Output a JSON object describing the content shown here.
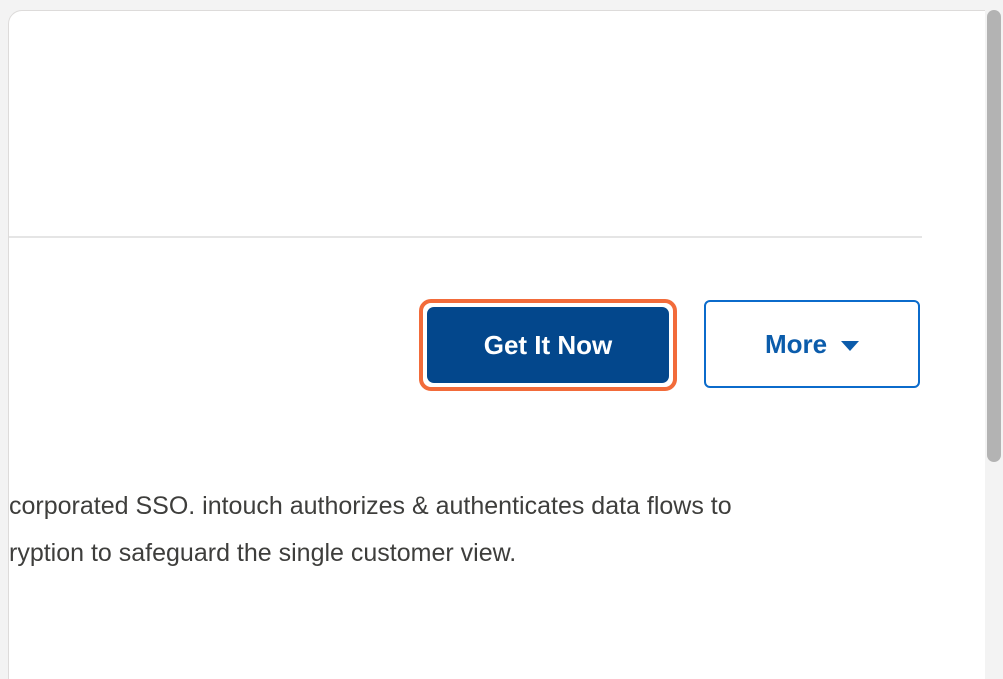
{
  "actions": {
    "primary_label": "Get It Now",
    "secondary_label": "More"
  },
  "description": {
    "line1": "corporated SSO. intouch authorizes & authenticates data flows to",
    "line2": "ryption to safeguard the single customer view."
  },
  "icons": {
    "more_caret": "caret-down-icon"
  },
  "colors": {
    "primary_bg": "#03478c",
    "primary_focus_ring": "#f26b3a",
    "secondary_border": "#0b6bcb",
    "secondary_text": "#0b5cab",
    "body_text": "#3e3e3c"
  }
}
